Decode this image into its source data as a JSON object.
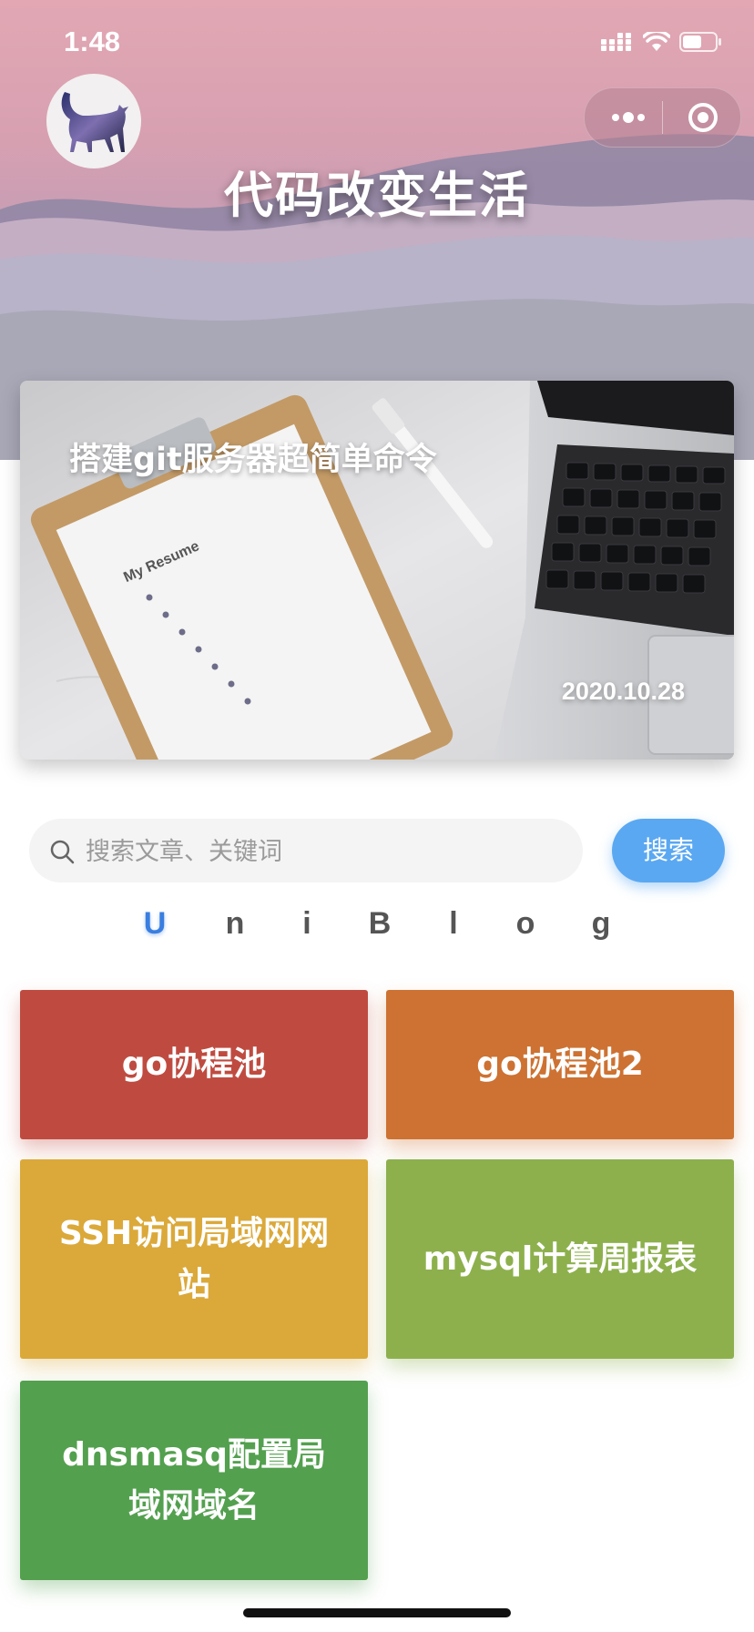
{
  "status_bar": {
    "time": "1:48"
  },
  "header": {
    "title": "代码改变生活"
  },
  "colors": {
    "accent": "#5aa8f2",
    "brand_active": "#3a7ee0",
    "tile_red": "#bf4b40",
    "tile_orange": "#cd7232",
    "tile_yellow": "#dba93a",
    "tile_lightgreen": "#8db04d",
    "tile_green": "#53a04f"
  },
  "banner": {
    "title": "搭建git服务器超简单命令",
    "date": "2020.10.28",
    "image_text": "My Resume"
  },
  "search": {
    "placeholder": "搜索文章、关键词",
    "value": "",
    "button_label": "搜索"
  },
  "brand": {
    "letters": [
      "U",
      "n",
      "i",
      "B",
      "l",
      "o",
      "g"
    ],
    "active_index": 0
  },
  "tiles": [
    {
      "label": "go协程池"
    },
    {
      "label": "go协程池2"
    },
    {
      "label": "SSH访问局域网网站"
    },
    {
      "label": "mysql计算周报表"
    },
    {
      "label": "dnsmasq配置局域网域名"
    }
  ],
  "icons": [
    "cellular-icon",
    "wifi-icon",
    "battery-icon",
    "more-icon",
    "close-icon",
    "search-icon",
    "cat-avatar-icon"
  ]
}
